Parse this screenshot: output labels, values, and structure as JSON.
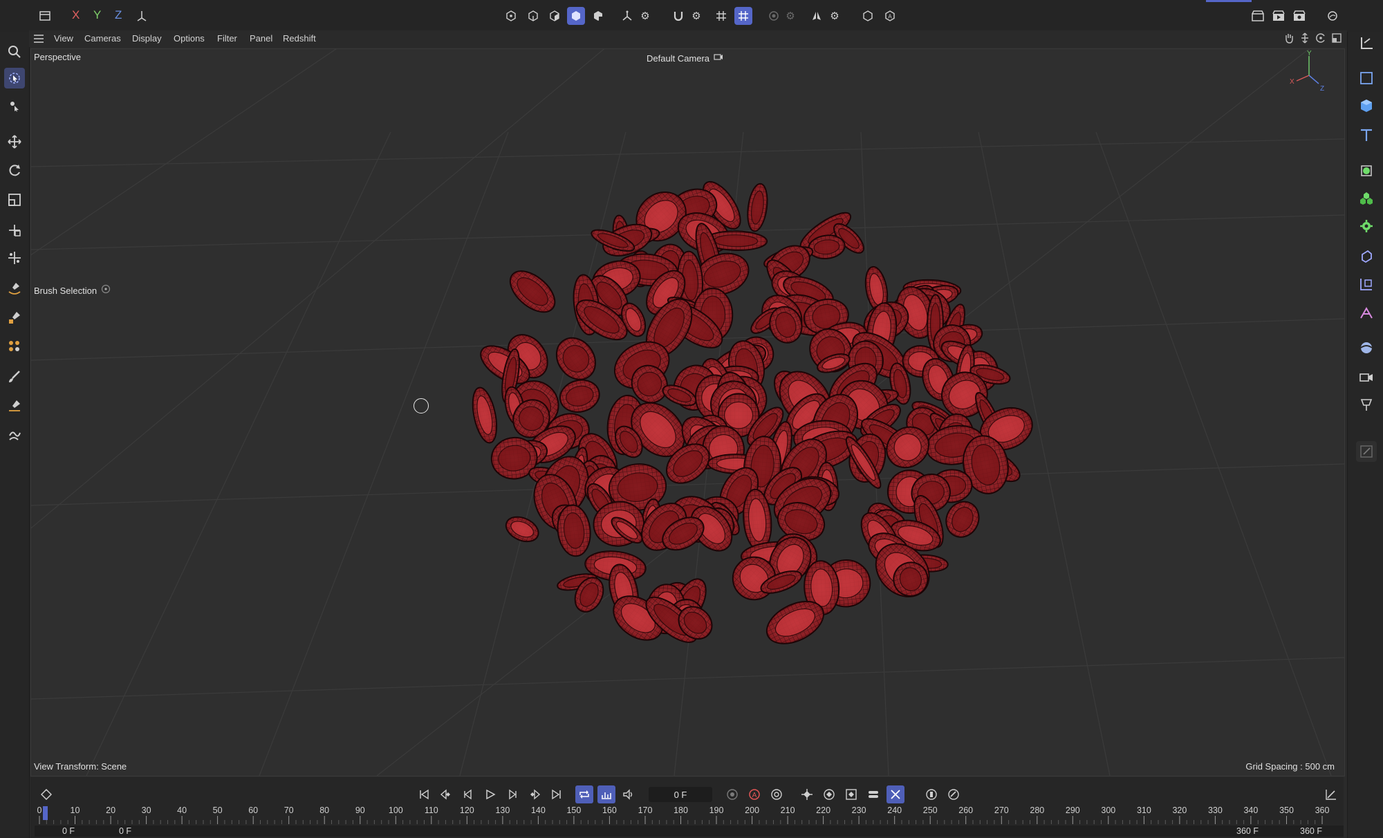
{
  "toolbar": {
    "axes": [
      "X",
      "Y",
      "Z"
    ]
  },
  "menu": [
    "View",
    "Cameras",
    "Display",
    "Options",
    "Filter",
    "Panel",
    "Redshift"
  ],
  "viewport": {
    "projection": "Perspective",
    "camera": "Default Camera",
    "tool": "Brush Selection",
    "view_transform": "View Transform: Scene",
    "grid_spacing": "Grid Spacing : 500 cm",
    "gizmo_axes": [
      "X",
      "Y",
      "Z"
    ]
  },
  "timeline": {
    "current_frame": "0 F",
    "ticks": [
      "0",
      "10",
      "20",
      "30",
      "40",
      "50",
      "60",
      "70",
      "80",
      "90",
      "100",
      "110",
      "120",
      "130",
      "140",
      "150",
      "160",
      "170",
      "180",
      "190",
      "200",
      "210",
      "220",
      "230",
      "240",
      "250",
      "260",
      "270",
      "280",
      "290",
      "300",
      "310",
      "320",
      "330",
      "340",
      "350",
      "360"
    ],
    "start_field": "0 F",
    "start_field2": "0 F",
    "end_field": "360 F",
    "end_field2": "360 F"
  },
  "colors": {
    "accent": "#5566c8",
    "cell": "#b0262c",
    "background": "#2f2f2f"
  }
}
